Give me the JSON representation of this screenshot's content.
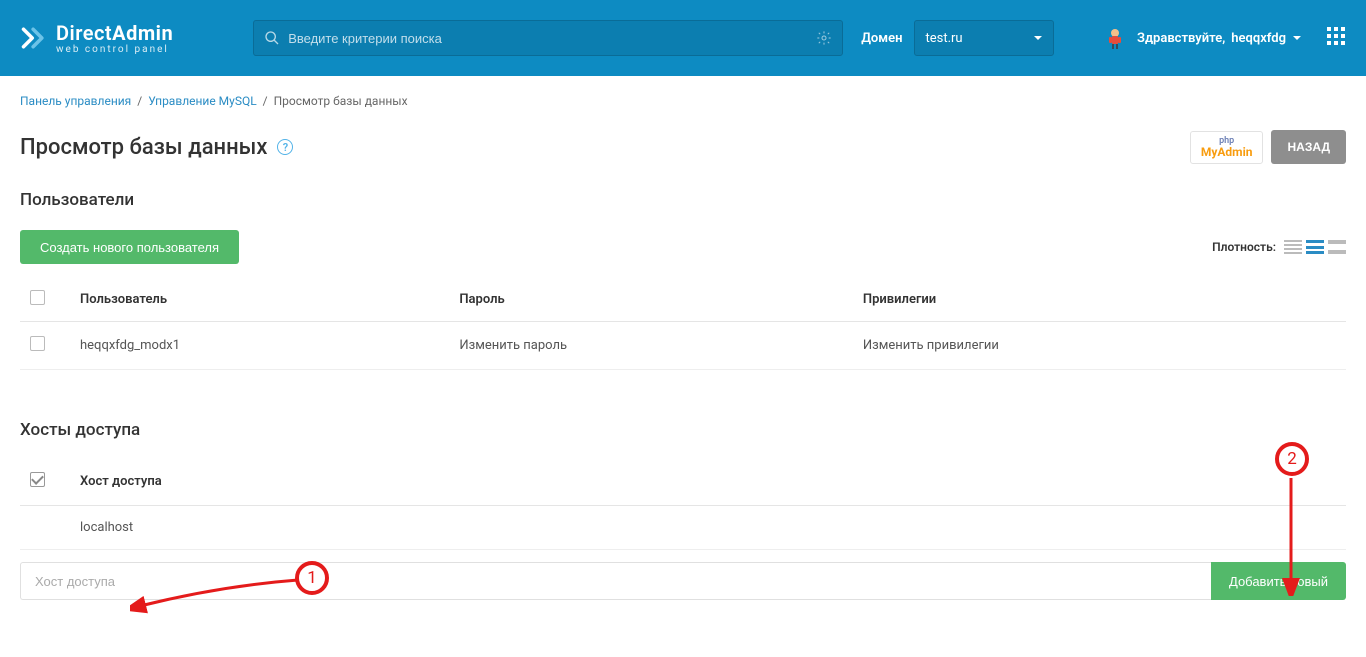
{
  "header": {
    "logo": {
      "line1_a": "Direct",
      "line1_b": "Admin",
      "line2": "web control panel"
    },
    "search_placeholder": "Введите критерии поиска",
    "domain_label": "Домен",
    "domain_value": "test.ru",
    "greeting_prefix": "Здравствуйте,",
    "greeting_user": "heqqxfdg"
  },
  "breadcrumb": {
    "item1": "Панель управления",
    "item2": "Управление MySQL",
    "item3": "Просмотр базы данных"
  },
  "page": {
    "title": "Просмотр базы данных",
    "phpmyadmin_l1": "php",
    "phpmyadmin_l2": "MyAdmin",
    "back_label": "НАЗАД"
  },
  "users_section": {
    "title": "Пользователи",
    "create_btn": "Создать нового пользователя",
    "density_label": "Плотность:",
    "cols": {
      "user": "Пользователь",
      "password": "Пароль",
      "privileges": "Привилегии"
    },
    "rows": [
      {
        "user": "heqqxfdg_modx1",
        "password": "Изменить пароль",
        "privileges": "Изменить привилегии"
      }
    ]
  },
  "hosts_section": {
    "title": "Хосты доступа",
    "col_host": "Хост доступа",
    "rows": [
      {
        "host": "localhost"
      }
    ],
    "input_placeholder": "Хост доступа",
    "add_btn": "Добавить новый"
  },
  "annotations": {
    "one": "1",
    "two": "2"
  }
}
